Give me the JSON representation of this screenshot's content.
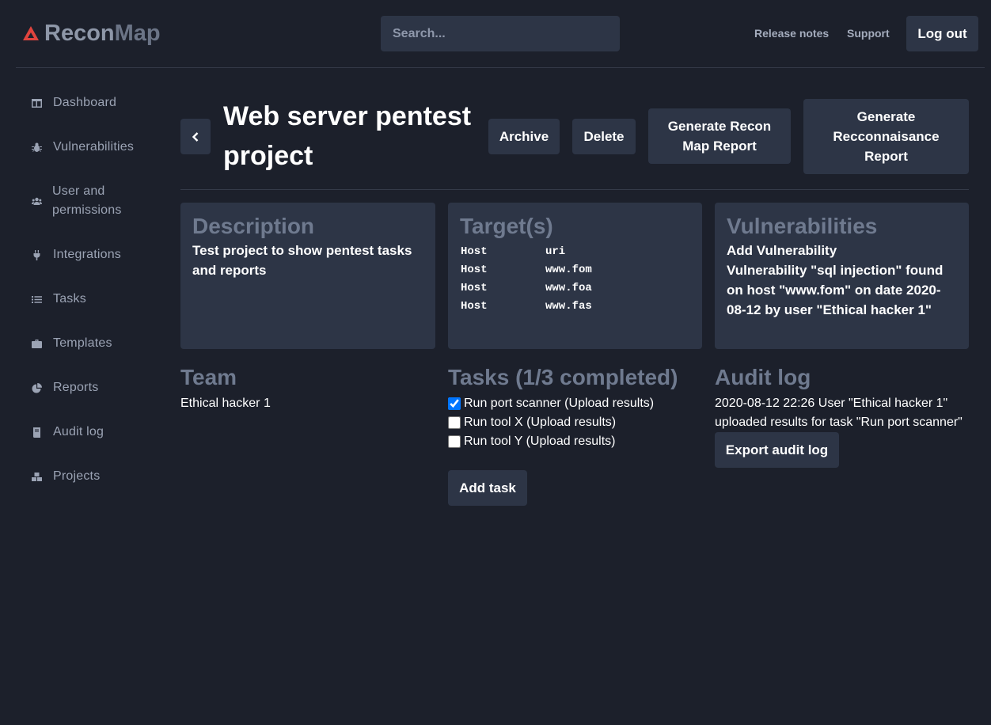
{
  "header": {
    "logo_part1": "Recon",
    "logo_part2": "Map",
    "search_placeholder": "Search...",
    "links": [
      "Release notes",
      "Support"
    ],
    "logout_label": "Log out"
  },
  "sidebar": {
    "items": [
      {
        "label": "Dashboard",
        "icon": "dashboard-icon"
      },
      {
        "label": "Vulnerabilities",
        "icon": "bug-icon"
      },
      {
        "label": "User and permissions",
        "icon": "users-icon"
      },
      {
        "label": "Integrations",
        "icon": "plug-icon"
      },
      {
        "label": "Tasks",
        "icon": "list-icon"
      },
      {
        "label": "Templates",
        "icon": "briefcase-icon"
      },
      {
        "label": "Reports",
        "icon": "pie-chart-icon"
      },
      {
        "label": "Audit log",
        "icon": "book-icon"
      },
      {
        "label": "Projects",
        "icon": "cubes-icon"
      }
    ]
  },
  "project": {
    "title": "Web server pentest project",
    "buttons": {
      "archive": "Archive",
      "delete": "Delete",
      "recon_map_report": "Generate Recon Map Report",
      "reconnaissance_report": "Generate Recconnaisance Report"
    }
  },
  "description": {
    "heading": "Description",
    "text": "Test project to show pentest tasks and reports"
  },
  "targets": {
    "heading": "Target(s)",
    "rows": [
      {
        "type": "Host",
        "value": "uri"
      },
      {
        "type": "Host",
        "value": "www.fom"
      },
      {
        "type": "Host",
        "value": "www.foa"
      },
      {
        "type": "Host",
        "value": "www.fas"
      }
    ]
  },
  "vulnerabilities": {
    "heading": "Vulnerabilities",
    "add_link": "Add Vulnerability",
    "entry": "Vulnerability \"sql injection\" found on host \"www.fom\" on date 2020-08-12 by user \"Ethical hacker 1\""
  },
  "team": {
    "heading": "Team",
    "members": [
      "Ethical hacker 1"
    ]
  },
  "tasks": {
    "heading": "Tasks (1/3 completed)",
    "items": [
      {
        "label": "Run port scanner (Upload results)",
        "checked": true
      },
      {
        "label": "Run tool X (Upload results)",
        "checked": false
      },
      {
        "label": "Run tool Y (Upload results)",
        "checked": false
      }
    ],
    "add_label": "Add task"
  },
  "audit_log": {
    "heading": "Audit log",
    "entry": "2020-08-12 22:26 User \"Ethical hacker 1\" uploaded results for task \"Run port scanner\"",
    "export_label": "Export audit log"
  },
  "colors": {
    "background": "#1c202b",
    "panel": "#2d3546",
    "muted_heading": "#6f7a8f",
    "logo_red": "#e0443e"
  }
}
